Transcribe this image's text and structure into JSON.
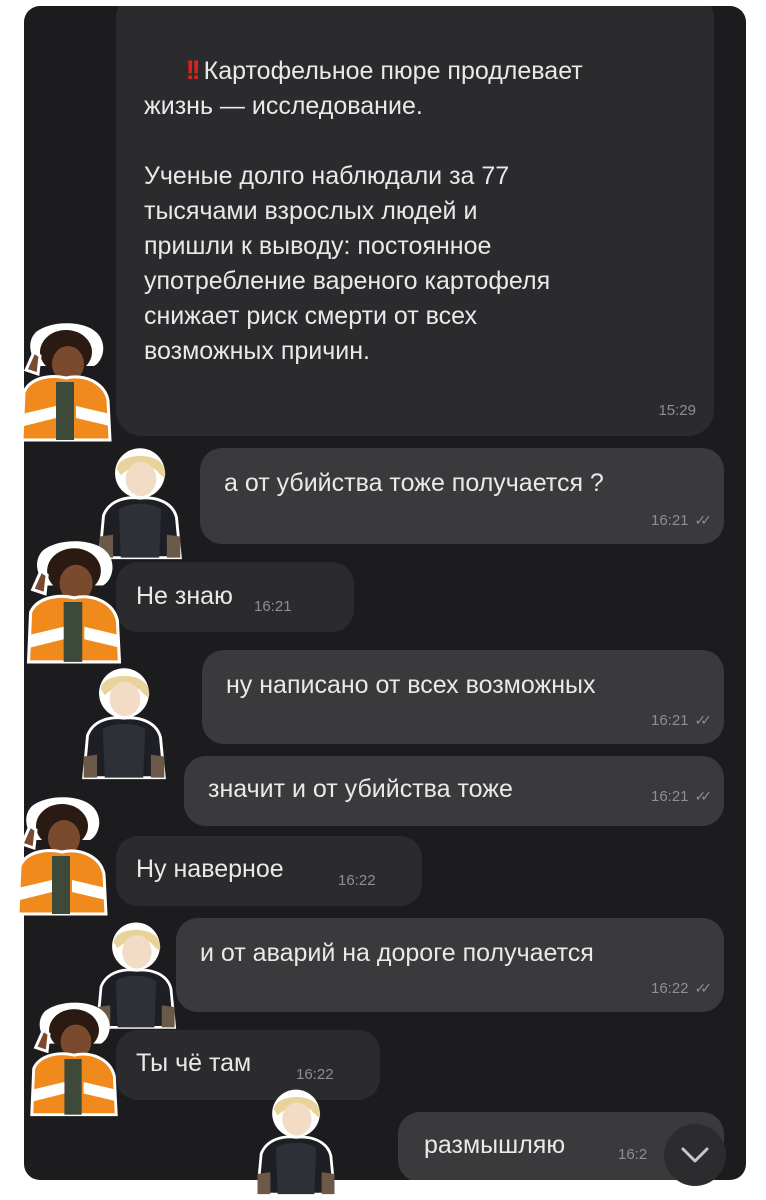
{
  "messages": [
    {
      "id": "m1",
      "direction": "incoming",
      "icon": "double-exclamation-icon",
      "text": "Картофельное пюре продлевает\nжизнь — исследование.\n\nУченые долго наблюдали за 77\nтысячами взрослых людей и\nпришли к выводу: постоянное\nупотребление вареного картофеля\nснижает риск смерти от всех\nвозможных причин.",
      "time": "15:29"
    },
    {
      "id": "m2",
      "direction": "outgoing",
      "text": "а от убийства тоже получается ?",
      "time": "16:21",
      "status_icon": "double-check-icon"
    },
    {
      "id": "m3",
      "direction": "incoming",
      "text": "Не знаю",
      "time": "16:21"
    },
    {
      "id": "m4",
      "direction": "outgoing",
      "text": "ну написано от всех возможных",
      "time": "16:21",
      "status_icon": "double-check-icon"
    },
    {
      "id": "m5",
      "direction": "outgoing",
      "text": "значит и от убийства тоже",
      "time": "16:21",
      "status_icon": "double-check-icon"
    },
    {
      "id": "m6",
      "direction": "incoming",
      "text": "Ну наверное",
      "time": "16:22"
    },
    {
      "id": "m7",
      "direction": "outgoing",
      "text": "и от аварий на дороге получается",
      "time": "16:22",
      "status_icon": "double-check-icon"
    },
    {
      "id": "m8",
      "direction": "incoming",
      "text": "Ты чё там",
      "time": "16:22"
    },
    {
      "id": "m9",
      "direction": "outgoing",
      "text": "размышляю",
      "time": "16:2"
    }
  ],
  "colors": {
    "background": "#1c1c1e",
    "incoming_bubble": "#2b2b2e",
    "outgoing_bubble": "#3a3a3c",
    "text": "#e9e9ea",
    "meta": "#8e8e93",
    "alert": "#e0201c",
    "avatar_jacket": "#f08a1c"
  },
  "icons": {
    "status": "double-check-icon",
    "scroll_down": "chevron-down-icon",
    "alert": "double-exclamation-icon"
  }
}
